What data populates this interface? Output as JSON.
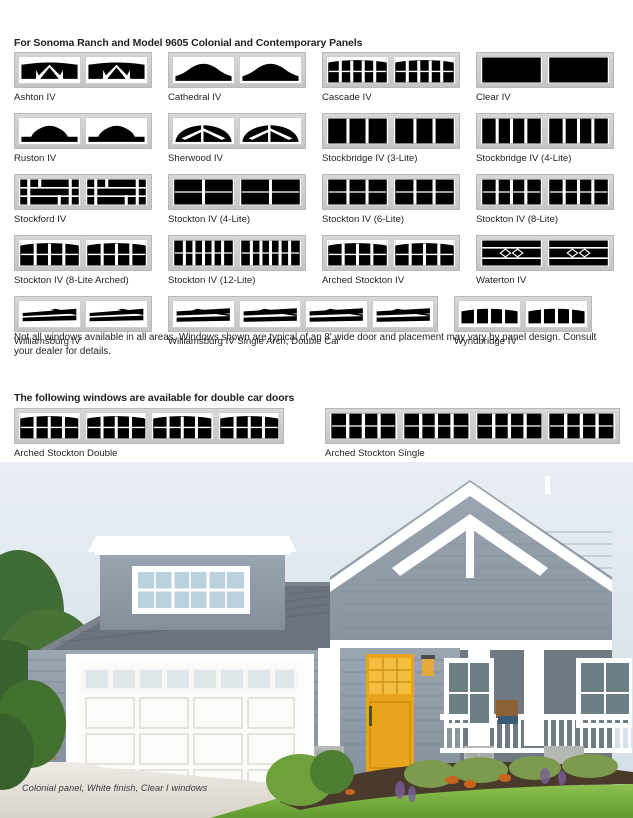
{
  "headings": {
    "main": "For Sonoma Ranch and Model 9605 Colonial and Contemporary Panels",
    "double": "The following windows are available for double car doors"
  },
  "disclaimer": "Not all windows available in all areas. Windows shown are typical of an 8' wide door and placement may vary by panel design. Consult your dealer for details.",
  "photo_caption": "Colonial panel, White finish, Clear I windows",
  "colors": {
    "text": "#231f20",
    "frame_fill": "#cfcfcf",
    "frame_border": "#b8b8b8",
    "glass": "#000000",
    "muntin": "#ffffff",
    "siding": "#8d9aa6",
    "trim": "#ffffff",
    "door": "#f0a81e",
    "roof": "#5d6570",
    "lawn": "#76b03e",
    "sky": "#dfe7ee",
    "driveway": "#e2ded7",
    "stone": "#b9bcbb"
  },
  "windows": [
    [
      {
        "name": "Ashton IV",
        "style": "ashton",
        "lites": 2
      },
      {
        "name": "Cathedral IV",
        "style": "cathedral",
        "lites": 2
      },
      {
        "name": "Cascade IV",
        "style": "cascade",
        "lites": 2
      },
      {
        "name": "Clear IV",
        "style": "clear",
        "lites": 2
      }
    ],
    [
      {
        "name": "Ruston IV",
        "style": "ruston",
        "lites": 2
      },
      {
        "name": "Sherwood IV",
        "style": "sherwood",
        "lites": 2
      },
      {
        "name": "Stockbridge IV (3-Lite)",
        "style": "stockbridge3",
        "lites": 2
      },
      {
        "name": "Stockbridge IV (4-Lite)",
        "style": "stockbridge4",
        "lites": 2
      }
    ],
    [
      {
        "name": "Stockford IV",
        "style": "stockford",
        "lites": 2
      },
      {
        "name": "Stockton IV (4-Lite)",
        "style": "stockton4",
        "lites": 2
      },
      {
        "name": "Stockton IV (6-Lite)",
        "style": "stockton6",
        "lites": 2
      },
      {
        "name": "Stockton IV (8-Lite)",
        "style": "stockton8",
        "lites": 2
      }
    ],
    [
      {
        "name": "Stockton IV (8-Lite Arched)",
        "style": "stockton8arch",
        "lites": 2
      },
      {
        "name": "Stockton IV (12-Lite)",
        "style": "stockton12",
        "lites": 2
      },
      {
        "name": "Arched Stockton IV",
        "style": "archedstockton",
        "lites": 2
      },
      {
        "name": "Waterton IV",
        "style": "waterton",
        "lites": 2
      }
    ],
    [
      {
        "name": "Williamsburg IV",
        "style": "williamsburg",
        "lites": 2
      },
      {
        "name": "Williamsburg IV Single Arch, Double Car",
        "style": "williamsburgdouble",
        "lites": 4
      },
      {
        "name": "Wyndbridge IV",
        "style": "wyndbridge",
        "lites": 2
      }
    ]
  ],
  "double_car_windows": [
    {
      "name": "Arched Stockton Double",
      "style": "archedstocktondouble",
      "lites": 4
    },
    {
      "name": "Arched Stockton Single",
      "style": "archedstocktonsingle",
      "lites": 4
    }
  ]
}
